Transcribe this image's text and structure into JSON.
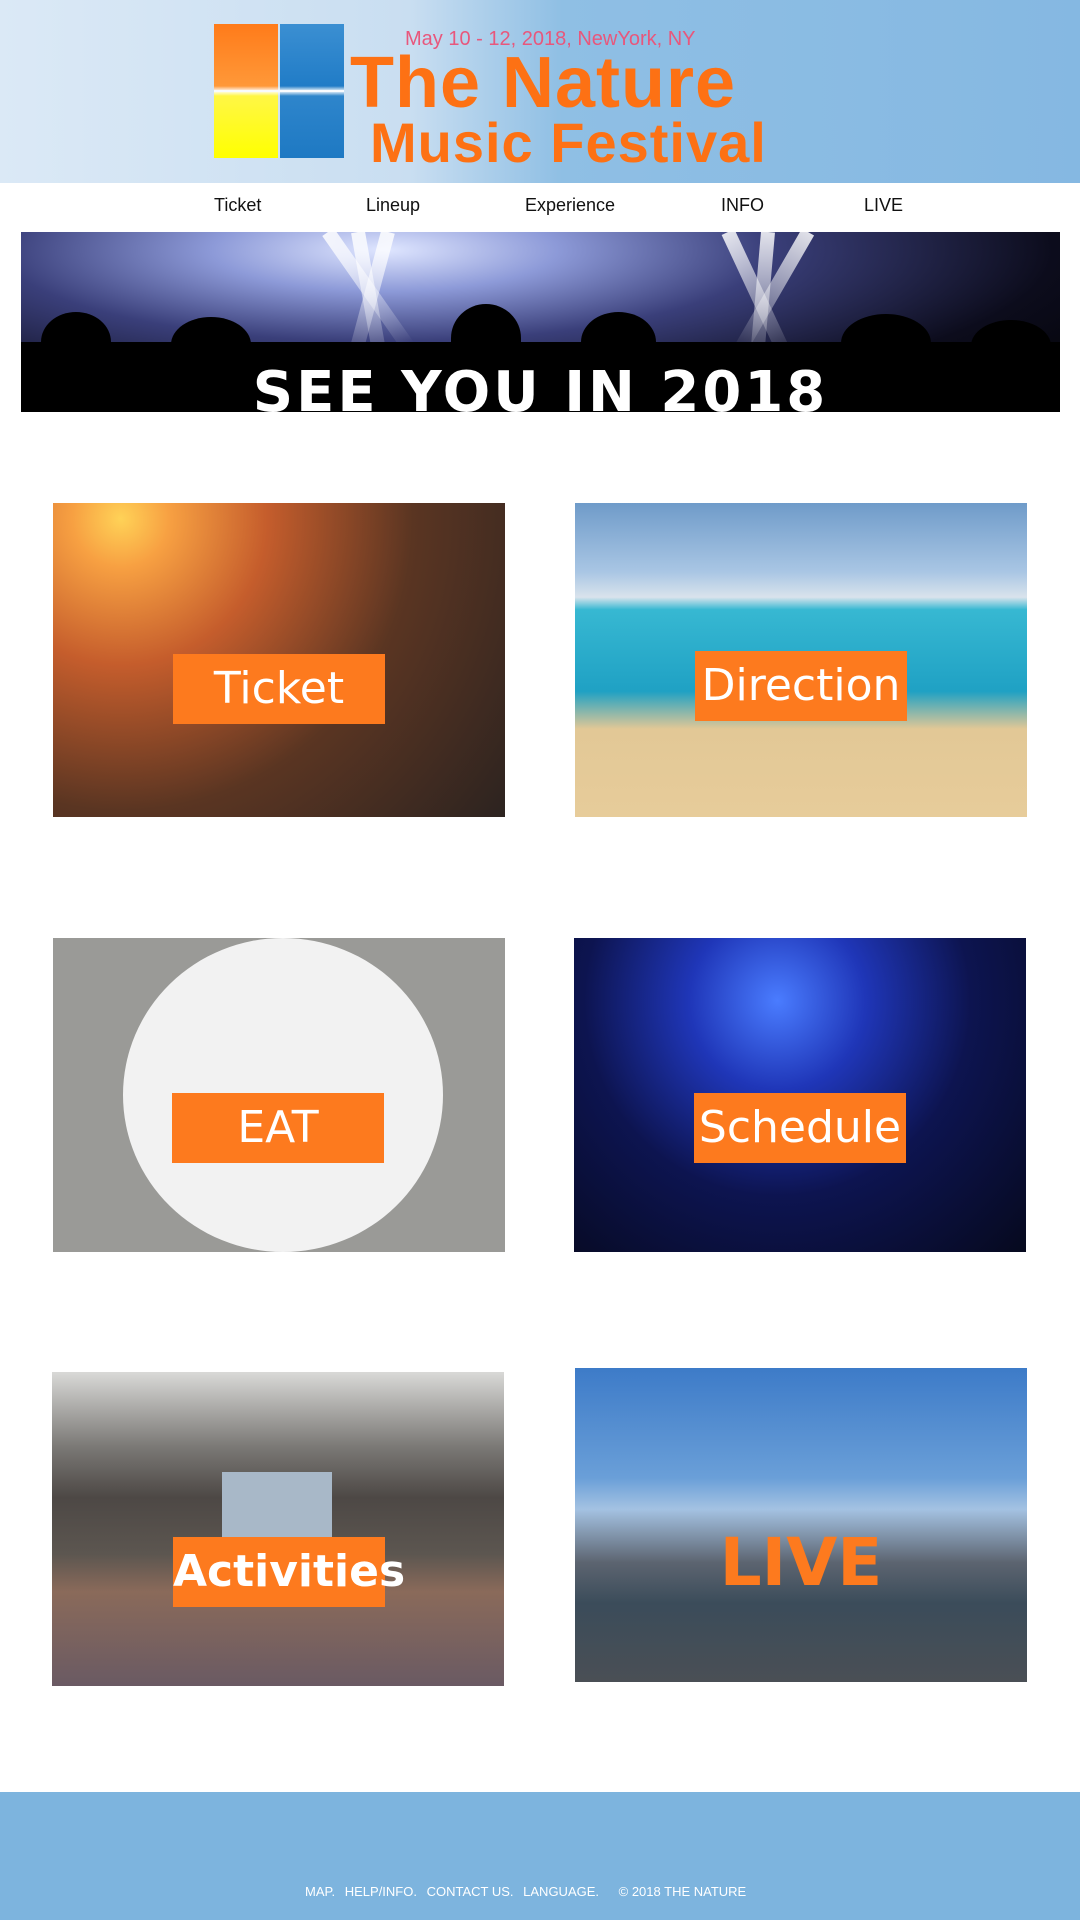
{
  "header": {
    "date": "May 10 - 12, 2018, NewYork, NY",
    "title_line1": "The Nature",
    "title_line2": "Music Festival"
  },
  "nav": {
    "items": [
      {
        "label": "Ticket"
      },
      {
        "label": "Lineup"
      },
      {
        "label": "Experience"
      },
      {
        "label": "INFO"
      },
      {
        "label": "LIVE"
      }
    ]
  },
  "banner": {
    "text": "SEE YOU IN 2018"
  },
  "tiles": [
    {
      "label": "Ticket"
    },
    {
      "label": "Direction"
    },
    {
      "label": "EAT"
    },
    {
      "label": "Schedule"
    },
    {
      "label": "Activities"
    },
    {
      "label": "LIVE"
    }
  ],
  "footer": {
    "links": [
      "MAP.",
      "HELP/INFO.",
      "CONTACT US.",
      "LANGUAGE."
    ],
    "copyright": "© 2018 THE NATURE"
  },
  "colors": {
    "accent_orange": "#fd7114",
    "header_blue": "#85b8e2",
    "footer_blue": "#7db4de",
    "date_pink": "#e8577c"
  }
}
